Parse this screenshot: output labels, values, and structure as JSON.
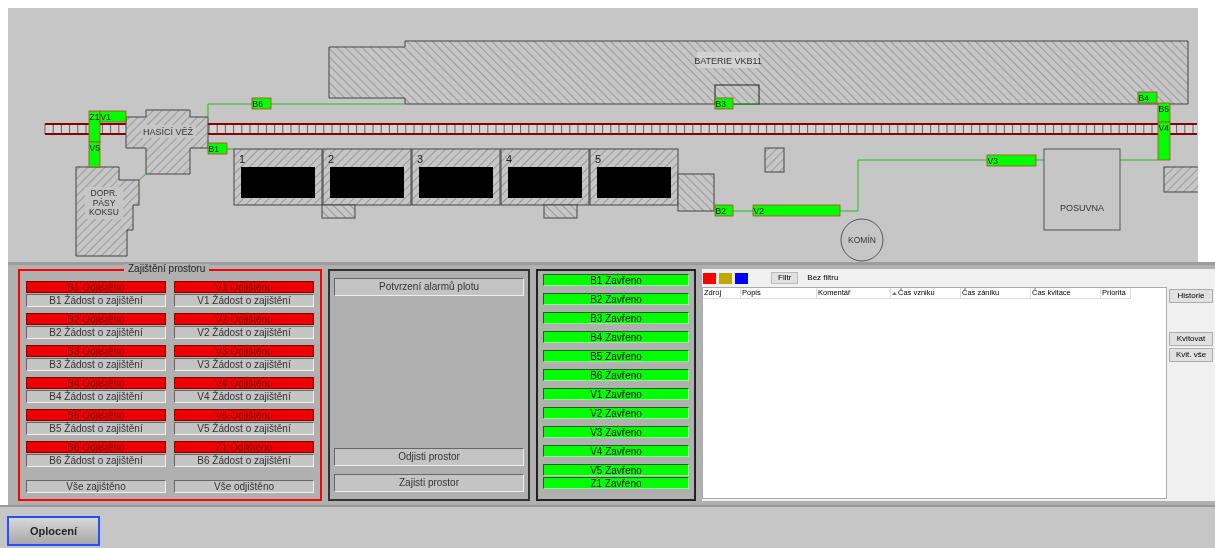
{
  "diagram": {
    "building_label": "BATERIE VKB11",
    "tower_label": "HASÍCÍ VĚŽ",
    "conveyor_label": [
      "DOPR.",
      "PÁSY",
      "KOKSU"
    ],
    "ovens": [
      "1",
      "2",
      "3",
      "4",
      "5"
    ],
    "transfer_label": "POSUVNA",
    "chimney_label": "KOMÍN",
    "markers": [
      {
        "label": "Z1",
        "closed": true
      },
      {
        "label": "V1",
        "closed": true
      },
      {
        "label": "V5",
        "closed": true
      },
      {
        "label": "B6",
        "closed": true
      },
      {
        "label": "B1",
        "closed": true
      },
      {
        "label": "B3",
        "closed": true
      },
      {
        "label": "B2",
        "closed": true
      },
      {
        "label": "V2",
        "closed": true
      },
      {
        "label": "V3",
        "closed": true
      },
      {
        "label": "B4",
        "closed": true
      },
      {
        "label": "B5",
        "closed": true
      },
      {
        "label": "V4",
        "closed": true
      }
    ]
  },
  "securing_panel": {
    "title": "Zajištění prostoru",
    "items": [
      {
        "status": "B1 Odjištěno",
        "secured": false,
        "request": "B1 Žádost o zajištění"
      },
      {
        "status": "V1 Odjištěno",
        "secured": false,
        "request": "V1 Žádost o zajištění"
      },
      {
        "status": "B2 Odjištěno",
        "secured": false,
        "request": "B2 Žádost o zajištění"
      },
      {
        "status": "V2 Odjištěno",
        "secured": false,
        "request": "V2 Žádost o zajištění"
      },
      {
        "status": "B3 Odjištěno",
        "secured": false,
        "request": "B3 Žádost o zajištění"
      },
      {
        "status": "V3 Odjištěno",
        "secured": false,
        "request": "V3 Žádost o zajištění"
      },
      {
        "status": "B4 Odjištěno",
        "secured": false,
        "request": "B4 Žádost o zajištění"
      },
      {
        "status": "V4 Odjištěno",
        "secured": false,
        "request": "V4 Žádost o zajištění"
      },
      {
        "status": "B5 Odjištěno",
        "secured": false,
        "request": "B5 Žádost o zajištění"
      },
      {
        "status": "V5 Odjištěno",
        "secured": false,
        "request": "V5 Žádost o zajištění"
      },
      {
        "status": "B6 Odjištěno",
        "secured": false,
        "request": "B6 Žádost o zajištění"
      },
      {
        "status": "Z1 Odjištěno",
        "secured": false,
        "request": "B6 Žádost o zajištění"
      }
    ],
    "footer_buttons": [
      "Vše zajištěno",
      "Vše odjištěno"
    ]
  },
  "actions": {
    "top": "Potvrzení alarmů plotu",
    "bottom": [
      "Odjisti prostor",
      "Zajisti prostor"
    ]
  },
  "gates": [
    {
      "label": "B1 Zavřeno",
      "closed": true
    },
    {
      "label": "B2 Zavřeno",
      "closed": true
    },
    {
      "label": "B3 Zavřeno",
      "closed": true
    },
    {
      "label": "B4 Zavřeno",
      "closed": true
    },
    {
      "label": "B5 Zavřeno",
      "closed": true
    },
    {
      "label": "B6 Zavřeno",
      "closed": true
    },
    {
      "label": "V1 Zavřeno",
      "closed": true
    },
    {
      "label": "V2 Zavřeno",
      "closed": true
    },
    {
      "label": "V3 Zavřeno",
      "closed": true
    },
    {
      "label": "V4 Zavřeno",
      "closed": true
    },
    {
      "label": "V5 Zavřeno",
      "closed": true
    },
    {
      "label": "Z1 Zavřeno",
      "closed": true
    }
  ],
  "alarms": {
    "filter_colors": [
      {
        "color": "#ff0000"
      },
      {
        "color": "#c0a800"
      },
      {
        "color": "#0000ff"
      }
    ],
    "filter_button": "Filtr",
    "filter_status": "Bez filtru",
    "columns": [
      {
        "label": "Zdroj",
        "sorted": false
      },
      {
        "label": "Popis",
        "sorted": false
      },
      {
        "label": "Komentář",
        "sorted": false
      },
      {
        "label": "Čas vzniku",
        "sorted": true
      },
      {
        "label": "Čas zániku",
        "sorted": false
      },
      {
        "label": "Čas kvitace",
        "sorted": false
      },
      {
        "label": "Priorita",
        "sorted": false
      }
    ],
    "buttons": [
      "Historie",
      "Kvitovat",
      "Kvit. vše"
    ]
  },
  "footer": {
    "button": "Oplocení",
    "selected": true
  }
}
